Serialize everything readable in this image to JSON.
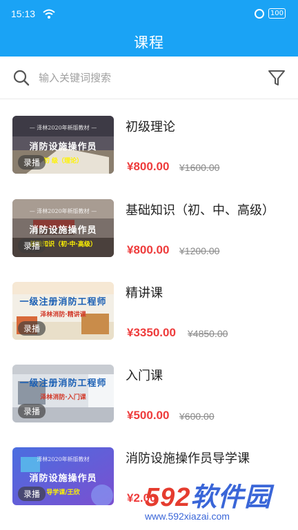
{
  "status": {
    "time": "15:13",
    "signal": "ᵡ",
    "battery": "100"
  },
  "header": {
    "title": "课程"
  },
  "search": {
    "placeholder": "输入关键词搜索"
  },
  "colors": {
    "accent": "#1aa3f5",
    "price": "#ee3b3b"
  },
  "courses": [
    {
      "title": "初级理论",
      "price": "¥800.00",
      "original": "¥1600.00",
      "tag": "录播",
      "thumb_top": "— 泽林2020年新版教材 —",
      "thumb_main": "消防设施操作员",
      "thumb_sub": "初 级（理论）"
    },
    {
      "title": "基础知识（初、中、高级）",
      "price": "¥800.00",
      "original": "¥1200.00",
      "tag": "录播",
      "thumb_top": "— 泽林2020年新版教材 —",
      "thumb_main": "消防设施操作员",
      "thumb_sub": "基础知识（初·中·高级）"
    },
    {
      "title": "精讲课",
      "price": "¥3350.00",
      "original": "¥4850.00",
      "tag": "录播",
      "thumb_top": "",
      "thumb_main": "一级注册消防工程师",
      "thumb_sub": "泽林消防·精讲课"
    },
    {
      "title": "入门课",
      "price": "¥500.00",
      "original": "¥600.00",
      "tag": "录播",
      "thumb_top": "",
      "thumb_main": "一级注册消防工程师",
      "thumb_sub": "泽林消防·入门课"
    },
    {
      "title": "消防设施操作员导学课",
      "price": "¥2.00",
      "original": "",
      "tag": "录播",
      "thumb_top": "泽林2020年新版教材",
      "thumb_main": "消防设施操作员",
      "thumb_sub": "导学课/王欣"
    }
  ],
  "watermark": {
    "logo_num": "592",
    "logo_text": "软件园",
    "url": "www.592xiazai.com"
  }
}
